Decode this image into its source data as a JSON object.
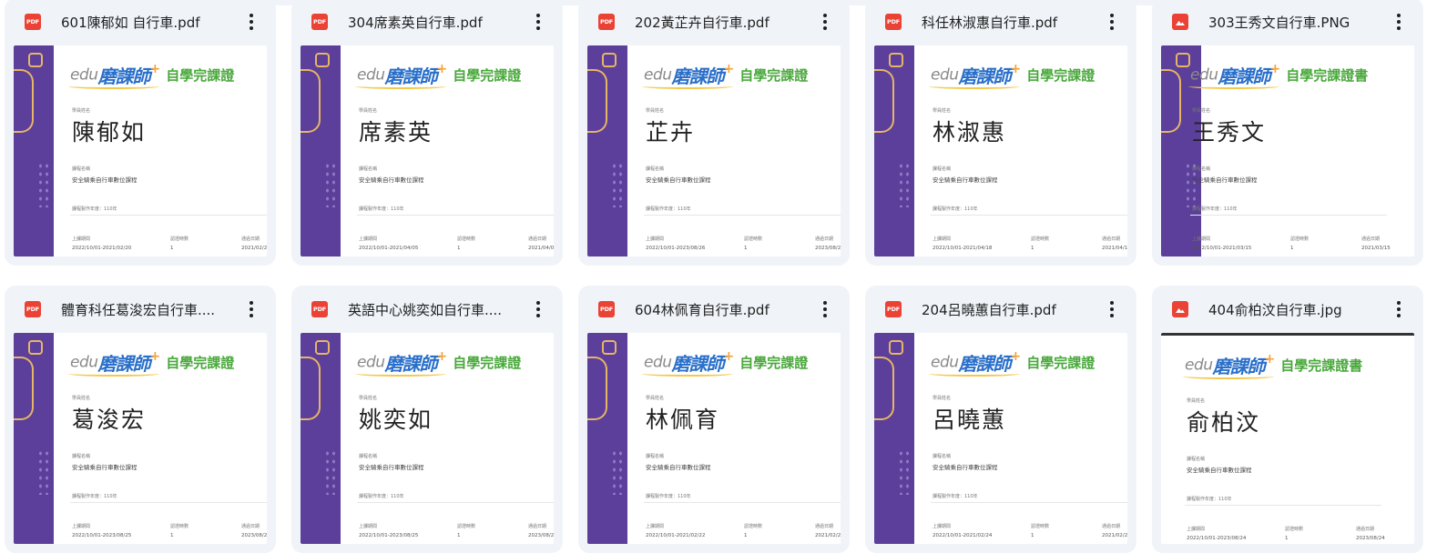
{
  "cert_labels": {
    "logo_edu": "edu",
    "logo_brand": "磨課師",
    "logo_plus": "+",
    "student_label": "學員姓名",
    "course_label": "課程名稱",
    "course_name": "安全騎乘自行車數位課程",
    "year_label": "課程製作年度：110年",
    "period_label": "上課期間",
    "count_label": "認證時數",
    "date_label": "通過日期",
    "count_value": "1"
  },
  "files": [
    {
      "name": "601陳郁如 自行車.pdf",
      "type": "pdf",
      "type_label": "PDF",
      "student": "陳郁如",
      "cert_title": "自學完課證",
      "period": "2022/10/01-2021/02/20",
      "pass_date": "2021/02/2"
    },
    {
      "name": "304席素英自行車.pdf",
      "type": "pdf",
      "type_label": "PDF",
      "student": "席素英",
      "cert_title": "自學完課證",
      "period": "2022/10/01-2021/04/05",
      "pass_date": "2021/04/0"
    },
    {
      "name": "202黃芷卉自行車.pdf",
      "type": "pdf",
      "type_label": "PDF",
      "student": "芷卉",
      "cert_title": "自學完課證",
      "period": "2022/10/01-2023/08/26",
      "pass_date": "2023/08/2"
    },
    {
      "name": "科任林淑惠自行車.pdf",
      "type": "pdf",
      "type_label": "PDF",
      "student": "林淑惠",
      "cert_title": "自學完課證",
      "period": "2022/10/01-2021/04/18",
      "pass_date": "2021/04/1"
    },
    {
      "name": "303王秀文自行車.PNG",
      "type": "image",
      "type_label": "",
      "student": "王秀文",
      "cert_title": "自學完課證書",
      "period": "2022/10/01-2021/03/15",
      "pass_date": "2021/03/15"
    },
    {
      "name": "體育科任葛浚宏自行車....",
      "type": "pdf",
      "type_label": "PDF",
      "student": "葛浚宏",
      "cert_title": "自學完課證",
      "period": "2022/10/01-2023/08/25",
      "pass_date": "2023/08/2"
    },
    {
      "name": "英語中心姚奕如自行車....",
      "type": "pdf",
      "type_label": "PDF",
      "student": "姚奕如",
      "cert_title": "自學完課證",
      "period": "2022/10/01-2023/08/25",
      "pass_date": "2023/08/2"
    },
    {
      "name": "604林佩育自行車.pdf",
      "type": "pdf",
      "type_label": "PDF",
      "student": "林佩育",
      "cert_title": "自學完課證",
      "period": "2022/10/01-2021/02/22",
      "pass_date": "2021/02/2"
    },
    {
      "name": "204呂曉蕙自行車.pdf",
      "type": "pdf",
      "type_label": "PDF",
      "student": "呂曉蕙",
      "cert_title": "自學完課證",
      "period": "2022/10/01-2021/02/24",
      "pass_date": "2021/02/2"
    },
    {
      "name": "404俞柏汶自行車.jpg",
      "type": "image",
      "type_label": "",
      "student": "俞柏汶",
      "cert_title": "自學完課證書",
      "period": "2022/10/01-2023/08/24",
      "pass_date": "2023/08/24"
    }
  ],
  "icons": {
    "pdf": "pdf-file-icon",
    "image": "image-file-icon",
    "more": "more-vert-icon"
  },
  "colors": {
    "card_bg": "#f0f4f9",
    "icon_red": "#ea4335",
    "cert_purple": "#5b3f9a",
    "cert_green": "#49a83b",
    "cert_blue": "#2a6fc9"
  }
}
